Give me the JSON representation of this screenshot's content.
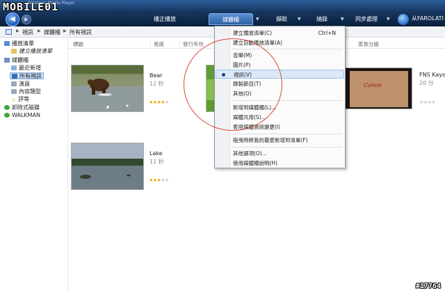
{
  "brand": "MOBILE01",
  "app_title": "Windows Media Player",
  "nav": {
    "tabs": [
      "播正播放",
      "媒體櫃",
      "擷取",
      "燒錄",
      "同步處理"
    ],
    "active_tab": "媒體櫃",
    "user": "从FAROLATI"
  },
  "breadcrumb": [
    "視訊",
    "媒體櫃",
    "所有視訊"
  ],
  "sidebar": {
    "items": [
      {
        "label": "播放清單",
        "level": 0,
        "icon": "playlist-icon"
      },
      {
        "label": "建立播放清單",
        "level": 1,
        "icon": "new-playlist-icon"
      },
      {
        "label": "媒體櫃",
        "level": 0,
        "icon": "library-icon"
      },
      {
        "label": "最近新增",
        "level": 1,
        "icon": "recent-icon"
      },
      {
        "label": "所有視訊",
        "level": 1,
        "icon": "video-icon",
        "selected": true
      },
      {
        "label": "演員",
        "level": 1,
        "icon": "actor-icon"
      },
      {
        "label": "內容類型",
        "level": 1,
        "icon": "genre-icon"
      },
      {
        "label": "評等",
        "level": 1,
        "icon": "rating-icon"
      },
      {
        "label": "卸除式磁碟",
        "level": 0,
        "icon": "removable-drive-icon"
      },
      {
        "label": "WALKMAN",
        "level": 0,
        "icon": "walkman-icon"
      }
    ]
  },
  "columns": [
    "標題",
    "長度",
    "發行年份",
    "家長分級"
  ],
  "videos": [
    {
      "title": "Bear",
      "length": "12 秒",
      "rating": 4
    },
    {
      "title": "Lake",
      "length": "11 秒",
      "rating": 3
    },
    {
      "title": "FNS Kayou",
      "length": "20 分",
      "rating": 0
    }
  ],
  "thumb_labels": {
    "canon": "Canon"
  },
  "menu": {
    "items": [
      {
        "label": "建立播放清單(C)",
        "shortcut": "Ctrl+N"
      },
      {
        "label": "建立自動播放清單(A)",
        "shortcut": ""
      },
      {
        "label": "音樂(M)",
        "shortcut": ""
      },
      {
        "label": "圖片(P)",
        "shortcut": ""
      },
      {
        "label": "視訊(V)",
        "shortcut": "",
        "checked": true,
        "highlighted": true
      },
      {
        "label": "錄製節目(T)",
        "shortcut": ""
      },
      {
        "label": "其他(O)",
        "shortcut": ""
      },
      {
        "label": "新增到媒體櫃(L)...",
        "shortcut": ""
      },
      {
        "label": "媒體共用(S)...",
        "shortcut": ""
      },
      {
        "label": "套用媒體資訊變更(I)",
        "shortcut": ""
      },
      {
        "label": "拖曳時將我的最愛新增到清單(F)",
        "shortcut": ""
      },
      {
        "label": "其他選項(O)...",
        "shortcut": ""
      },
      {
        "label": "使用媒體櫃說明(H)",
        "shortcut": ""
      }
    ]
  },
  "watermark": "#17764",
  "colors": {
    "topbar": "#16365f",
    "accent": "#2f62a8",
    "annotation": "#d9453a",
    "star": "#e6a800"
  }
}
